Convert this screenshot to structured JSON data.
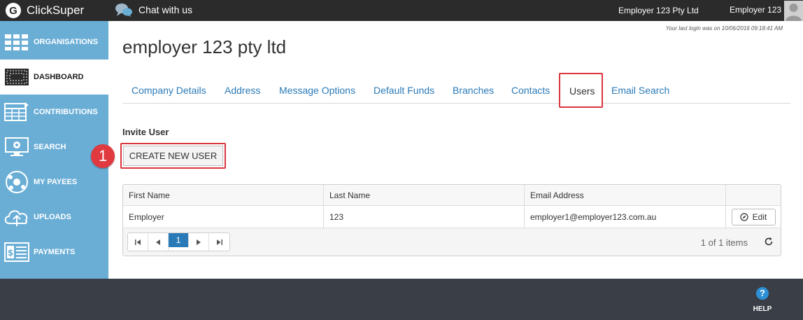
{
  "header": {
    "brand_letter": "G",
    "brand_name": "ClickSuper",
    "chat_label": "Chat with us",
    "organisation": "Employer 123 Pty Ltd",
    "user": "Employer 123"
  },
  "sidebar": {
    "items": [
      {
        "label": "ORGANISATIONS",
        "icon": "organisations-icon",
        "active": false
      },
      {
        "label": "DASHBOARD",
        "icon": "dashboard-icon",
        "active": true
      },
      {
        "label": "CONTRIBUTIONS",
        "icon": "contributions-icon",
        "active": false
      },
      {
        "label": "SEARCH",
        "icon": "search-icon",
        "active": false
      },
      {
        "label": "MY PAYEES",
        "icon": "payees-icon",
        "active": false
      },
      {
        "label": "UPLOADS",
        "icon": "upload-cloud-icon",
        "active": false
      },
      {
        "label": "PAYMENTS",
        "icon": "payments-icon",
        "active": false
      }
    ]
  },
  "main": {
    "last_login": "Your last login was on 10/06/2016 09:18:41 AM",
    "title": "employer 123 pty ltd",
    "tabs": [
      {
        "label": "Company Details"
      },
      {
        "label": "Address"
      },
      {
        "label": "Message Options"
      },
      {
        "label": "Default Funds"
      },
      {
        "label": "Branches"
      },
      {
        "label": "Contacts"
      },
      {
        "label": "Users",
        "active": true
      },
      {
        "label": "Email Search"
      }
    ],
    "invite_label": "Invite User",
    "create_button": "CREATE NEW USER",
    "step_number": "1",
    "grid": {
      "columns": [
        "First Name",
        "Last Name",
        "Email Address",
        ""
      ],
      "rows": [
        {
          "first_name": "Employer",
          "last_name": "123",
          "email": "employer1@employer123.com.au",
          "action": "Edit"
        }
      ],
      "pager": {
        "current_page": "1",
        "info": "1 of 1 items"
      }
    }
  },
  "footer": {
    "help_label": "HELP",
    "help_icon": "?"
  },
  "colors": {
    "topbar": "#2b2b2b",
    "sidebar": "#6aaed6",
    "link": "#2a7ab8",
    "highlight": "#d9363e",
    "footer": "#3a3f47"
  }
}
